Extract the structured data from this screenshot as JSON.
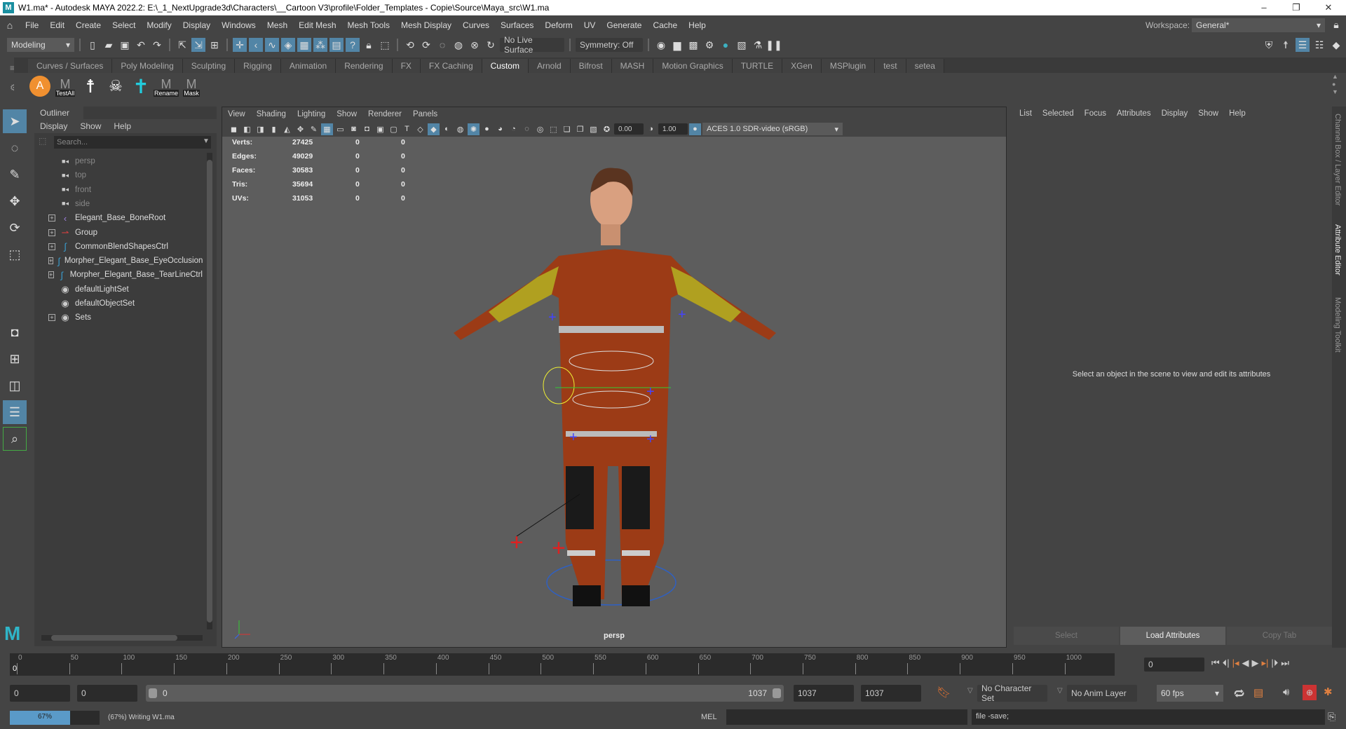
{
  "window": {
    "title": "W1.ma* - Autodesk MAYA 2022.2: E:\\_1_NextUpgrade3d\\Characters\\__Cartoon V3\\profile\\Folder_Templates - Copie\\Source\\Maya_src\\W1.ma",
    "logo": "M",
    "minimize": "–",
    "maximize": "❐",
    "close": "✕"
  },
  "menus": [
    "File",
    "Edit",
    "Create",
    "Select",
    "Modify",
    "Display",
    "Windows",
    "Mesh",
    "Edit Mesh",
    "Mesh Tools",
    "Mesh Display",
    "Curves",
    "Surfaces",
    "Deform",
    "UV",
    "Generate",
    "Cache",
    "Help"
  ],
  "workspace": {
    "label": "Workspace:",
    "value": "General*"
  },
  "statusline": {
    "mode": "Modeling",
    "live_surface": "No Live Surface",
    "symmetry": "Symmetry: Off"
  },
  "shelf_tabs": [
    "Curves / Surfaces",
    "Poly Modeling",
    "Sculpting",
    "Rigging",
    "Animation",
    "Rendering",
    "FX",
    "FX Caching",
    "Custom",
    "Arnold",
    "Bifrost",
    "MASH",
    "Motion Graphics",
    "TURTLE",
    "XGen",
    "MSPlugin",
    "test",
    "setea"
  ],
  "shelf_active": "Custom",
  "shelf_buttons": [
    {
      "label": ""
    },
    {
      "label": "TestAll"
    },
    {
      "label": ""
    },
    {
      "label": ""
    },
    {
      "label": ""
    },
    {
      "label": "Rename"
    },
    {
      "label": "Mask"
    }
  ],
  "outliner": {
    "title": "Outliner",
    "menus": [
      "Display",
      "Show",
      "Help"
    ],
    "search_placeholder": "Search...",
    "items": [
      {
        "name": "persp",
        "icon": "camera",
        "dim": true,
        "exp": false
      },
      {
        "name": "top",
        "icon": "camera",
        "dim": true,
        "exp": false
      },
      {
        "name": "front",
        "icon": "camera",
        "dim": true,
        "exp": false
      },
      {
        "name": "side",
        "icon": "camera",
        "dim": true,
        "exp": false
      },
      {
        "name": "Elegant_Base_BoneRoot",
        "icon": "joint",
        "exp": true
      },
      {
        "name": "Group",
        "icon": "group",
        "exp": true
      },
      {
        "name": "CommonBlendShapesCtrl",
        "icon": "curve",
        "exp": true
      },
      {
        "name": "Morpher_Elegant_Base_EyeOcclusion",
        "icon": "curve",
        "exp": true
      },
      {
        "name": "Morpher_Elegant_Base_TearLineCtrl",
        "icon": "curve",
        "exp": true
      },
      {
        "name": "defaultLightSet",
        "icon": "set",
        "exp": false
      },
      {
        "name": "defaultObjectSet",
        "icon": "set",
        "exp": false
      },
      {
        "name": "Sets",
        "icon": "set",
        "exp": true
      }
    ]
  },
  "viewport": {
    "menus": [
      "View",
      "Shading",
      "Lighting",
      "Show",
      "Renderer",
      "Panels"
    ],
    "exposure": "0.00",
    "gamma": "1.00",
    "color_space": "ACES 1.0 SDR-video (sRGB)",
    "camera": "persp",
    "hud": [
      {
        "label": "Verts:",
        "v": [
          "27425",
          "0",
          "0"
        ]
      },
      {
        "label": "Edges:",
        "v": [
          "49029",
          "0",
          "0"
        ]
      },
      {
        "label": "Faces:",
        "v": [
          "30583",
          "0",
          "0"
        ]
      },
      {
        "label": "Tris:",
        "v": [
          "35694",
          "0",
          "0"
        ]
      },
      {
        "label": "UVs:",
        "v": [
          "31053",
          "0",
          "0"
        ]
      }
    ]
  },
  "attribute_editor": {
    "menus": [
      "List",
      "Selected",
      "Focus",
      "Attributes",
      "Display",
      "Show",
      "Help"
    ],
    "message": "Select an object in the scene to view and edit its attributes",
    "buttons": [
      "Select",
      "Load Attributes",
      "Copy Tab"
    ]
  },
  "side_tabs": [
    "Channel Box / Layer Editor",
    "Attribute Editor",
    "Modeling Toolkit"
  ],
  "timeline": {
    "ticks": [
      "0",
      "50",
      "100",
      "150",
      "200",
      "250",
      "300",
      "350",
      "400",
      "450",
      "500",
      "550",
      "600",
      "650",
      "700",
      "750",
      "800",
      "850",
      "900",
      "950",
      "1000"
    ],
    "max": 1037,
    "current_marker": "0",
    "current_frame": "0"
  },
  "range": {
    "start": "0",
    "anim_start": "0",
    "slider_start": "0",
    "slider_end": "1037",
    "anim_end": "1037",
    "end": "1037",
    "character_set": "No Character Set",
    "anim_layer": "No Anim Layer",
    "fps": "60 fps"
  },
  "status": {
    "progress_pct": 67,
    "progress_label": "67%",
    "message": "(67%) Writing W1.ma",
    "cmd_lang": "MEL",
    "cmd_result": "file -save;"
  }
}
